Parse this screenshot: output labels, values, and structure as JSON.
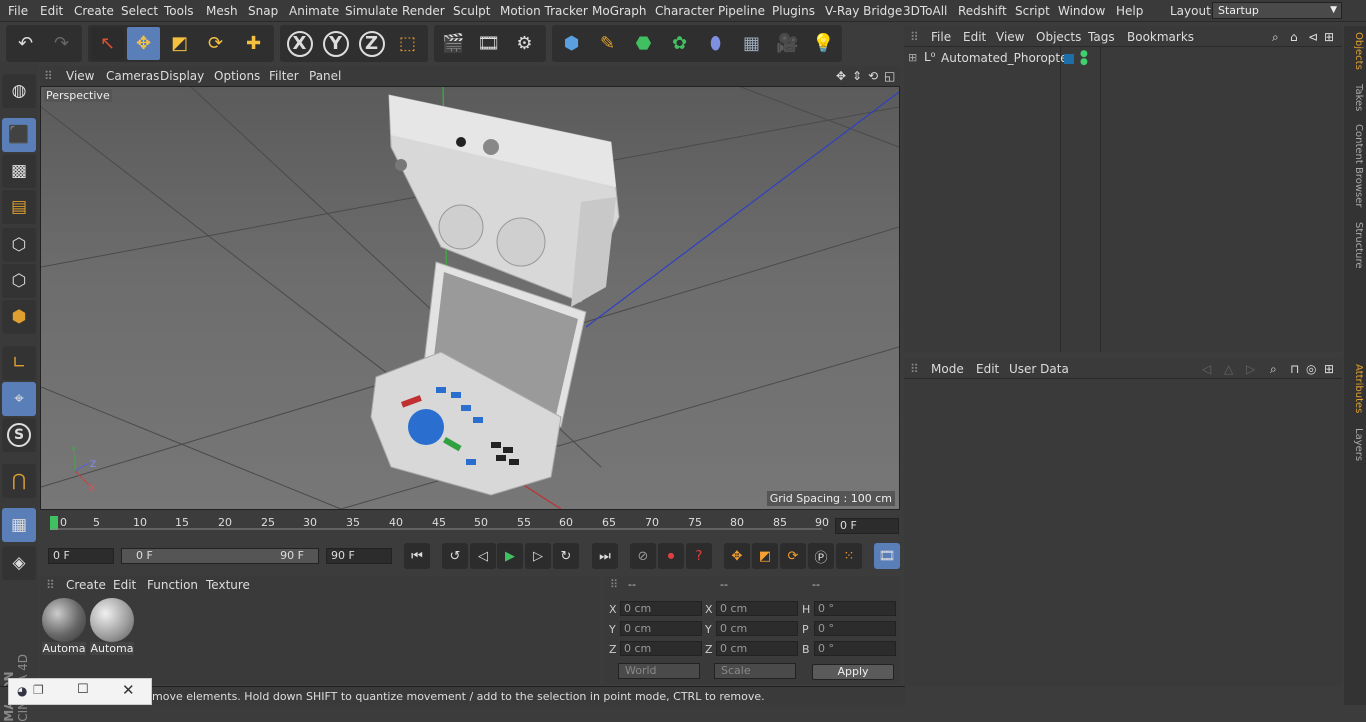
{
  "menu": [
    "File",
    "Edit",
    "Create",
    "Select",
    "Tools",
    "Mesh",
    "Snap",
    "Animate",
    "Simulate",
    "Render",
    "Sculpt",
    "Motion Tracker",
    "MoGraph",
    "Character",
    "Pipeline",
    "Plugins",
    "V-Ray Bridge",
    "3DToAll",
    "Redshift",
    "Script",
    "Window",
    "Help"
  ],
  "layout": {
    "label": "Layout:",
    "value": "Startup"
  },
  "viewport": {
    "menu": [
      "View",
      "Cameras",
      "Display",
      "Options",
      "Filter",
      "Panel"
    ],
    "camera_label": "Perspective",
    "grid_spacing": "Grid Spacing : 100 cm"
  },
  "timeline": {
    "ticks": [
      "0",
      "5",
      "10",
      "15",
      "20",
      "25",
      "30",
      "35",
      "40",
      "45",
      "50",
      "55",
      "60",
      "65",
      "70",
      "75",
      "80",
      "85",
      "90"
    ],
    "current_frame": "0 F"
  },
  "transport": {
    "start_field": "0 F",
    "range_start": "0 F",
    "range_end": "90 F",
    "end_field": "90 F"
  },
  "materials": {
    "menu": [
      "Create",
      "Edit",
      "Function",
      "Texture"
    ],
    "items": [
      {
        "label": "Automa"
      },
      {
        "label": "Automa"
      }
    ]
  },
  "coordinates": {
    "headers": [
      "--",
      "--",
      "--"
    ],
    "rows": [
      {
        "a": "X",
        "av": "0 cm",
        "b": "X",
        "bv": "0 cm",
        "c": "H",
        "cv": "0 °"
      },
      {
        "a": "Y",
        "av": "0 cm",
        "b": "Y",
        "bv": "0 cm",
        "c": "P",
        "cv": "0 °"
      },
      {
        "a": "Z",
        "av": "0 cm",
        "b": "Z",
        "bv": "0 cm",
        "c": "B",
        "cv": "0 °"
      }
    ],
    "world": "World",
    "scale": "Scale",
    "apply": "Apply"
  },
  "status_text": "move elements. Hold down SHIFT to quantize movement / add to the selection in point mode, CTRL to remove.",
  "objects": {
    "menu": [
      "File",
      "Edit",
      "View",
      "Objects",
      "Tags",
      "Bookmarks"
    ],
    "items": [
      {
        "name": "Automated_Phoropter"
      }
    ]
  },
  "attributes": {
    "menu": [
      "Mode",
      "Edit",
      "User Data"
    ]
  },
  "side_tabs": [
    "Objects",
    "Takes",
    "Content Browser",
    "Structure",
    "Attributes",
    "Layers"
  ],
  "brand": {
    "line1": "MAXON",
    "line2": "CINEMA 4D"
  },
  "colors": {
    "accent": "#5a7fb8",
    "active_tab": "#e0a030"
  }
}
